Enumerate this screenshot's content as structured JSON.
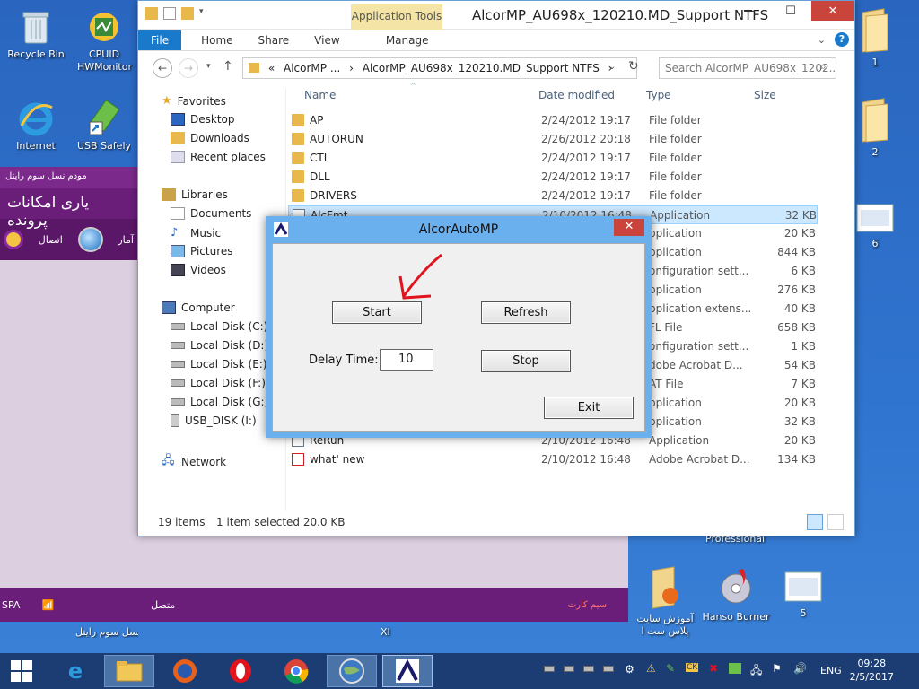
{
  "desktop": {
    "left_icons": [
      {
        "label": "Recycle Bin"
      },
      {
        "label": "CPUID HWMonitor"
      },
      {
        "label": "Internet Explorer"
      },
      {
        "label": "USB Safely Remove"
      }
    ],
    "right_icons": [
      {
        "label": "1"
      },
      {
        "label": "2"
      },
      {
        "label": "6"
      },
      {
        "label": "Professional"
      },
      {
        "label": "آموزش سایت پلاس ست ا"
      },
      {
        "label": "Hanso Burner"
      },
      {
        "label": "5"
      },
      {
        "label": "XI"
      }
    ]
  },
  "purple_app": {
    "header": "مودم نسل سوم رایتل",
    "title": "یاری امکانات پرونده",
    "connect_label": "اتصال",
    "side_label": "آمار",
    "status_left": "SPA",
    "status_connected": "متصل",
    "status_sim": "سیم کارت",
    "bottom_caption": "مودم نسل سوم رایتل"
  },
  "explorer": {
    "app_tools": "Application Tools",
    "title": "AlcorMP_AU698x_120210.MD_Support NTFS",
    "ribbon_tabs": [
      "File",
      "Home",
      "Share",
      "View",
      "Manage"
    ],
    "address_segments": [
      "«",
      "AlcorMP ...",
      "›",
      "AlcorMP_AU698x_120210.MD_Support NTFS",
      "›"
    ],
    "search_placeholder": "Search AlcorMP_AU698x_1202...",
    "nav": {
      "favorites": "Favorites",
      "desktop": "Desktop",
      "downloads": "Downloads",
      "recent": "Recent places",
      "libraries": "Libraries",
      "documents": "Documents",
      "music": "Music",
      "pictures": "Pictures",
      "videos": "Videos",
      "computer": "Computer",
      "disk_c": "Local Disk (C:)",
      "disk_d": "Local Disk (D:)",
      "disk_e": "Local Disk (E:)",
      "disk_f": "Local Disk (F:)",
      "disk_g": "Local Disk (G:)",
      "usb": "USB_DISK (I:)",
      "network": "Network"
    },
    "columns": {
      "name": "Name",
      "date": "Date modified",
      "type": "Type",
      "size": "Size"
    },
    "files": [
      {
        "name": "AP",
        "date": "2/24/2012 19:17",
        "type": "File folder",
        "size": "",
        "kind": "folder"
      },
      {
        "name": "AUTORUN",
        "date": "2/26/2012 20:18",
        "type": "File folder",
        "size": "",
        "kind": "folder"
      },
      {
        "name": "CTL",
        "date": "2/24/2012 19:17",
        "type": "File folder",
        "size": "",
        "kind": "folder"
      },
      {
        "name": "DLL",
        "date": "2/24/2012 19:17",
        "type": "File folder",
        "size": "",
        "kind": "folder"
      },
      {
        "name": "DRIVERS",
        "date": "2/24/2012 19:17",
        "type": "File folder",
        "size": "",
        "kind": "folder"
      },
      {
        "name": "AlcFmt",
        "date": "2/10/2012 16:48",
        "type": "Application",
        "size": "32 KB",
        "kind": "app"
      },
      {
        "name": "",
        "date": "",
        "type": "pplication",
        "size": "20 KB",
        "kind": "hidden"
      },
      {
        "name": "",
        "date": "",
        "type": "pplication",
        "size": "844 KB",
        "kind": "hidden"
      },
      {
        "name": "",
        "date": "",
        "type": "onfiguration sett...",
        "size": "6 KB",
        "kind": "hidden"
      },
      {
        "name": "",
        "date": "",
        "type": "pplication",
        "size": "276 KB",
        "kind": "hidden"
      },
      {
        "name": "",
        "date": "",
        "type": "pplication extens...",
        "size": "40 KB",
        "kind": "hidden"
      },
      {
        "name": "",
        "date": "",
        "type": "FL File",
        "size": "658 KB",
        "kind": "hidden"
      },
      {
        "name": "",
        "date": "",
        "type": "onfiguration sett...",
        "size": "1 KB",
        "kind": "hidden"
      },
      {
        "name": "",
        "date": "",
        "type": "dobe Acrobat D...",
        "size": "54 KB",
        "kind": "hidden"
      },
      {
        "name": "",
        "date": "",
        "type": "AT File",
        "size": "7 KB",
        "kind": "hidden"
      },
      {
        "name": "",
        "date": "",
        "type": "pplication",
        "size": "20 KB",
        "kind": "hidden"
      },
      {
        "name": "",
        "date": "",
        "type": "pplication",
        "size": "32 KB",
        "kind": "hidden"
      },
      {
        "name": "ReRun",
        "date": "2/10/2012 16:48",
        "type": "Application",
        "size": "20 KB",
        "kind": "app"
      },
      {
        "name": "what' new",
        "date": "2/10/2012 16:48",
        "type": "Adobe Acrobat D...",
        "size": "134 KB",
        "kind": "pdf"
      }
    ],
    "status": {
      "count": "19 items",
      "selected": "1 item selected  20.0 KB"
    }
  },
  "dialog": {
    "title": "AlcorAutoMP",
    "close": "✕",
    "start": "Start",
    "refresh": "Refresh",
    "delay_label": "Delay Time:",
    "delay_value": "10",
    "stop": "Stop",
    "exit": "Exit"
  },
  "taskbar": {
    "lang": "ENG",
    "time": "09:28",
    "date": "2/5/2017"
  },
  "colors": {
    "accent": "#1979ca",
    "dialog_frame": "#6bb0ee",
    "close_red": "#c9443a",
    "annotation_arrow": "#e0141e"
  }
}
